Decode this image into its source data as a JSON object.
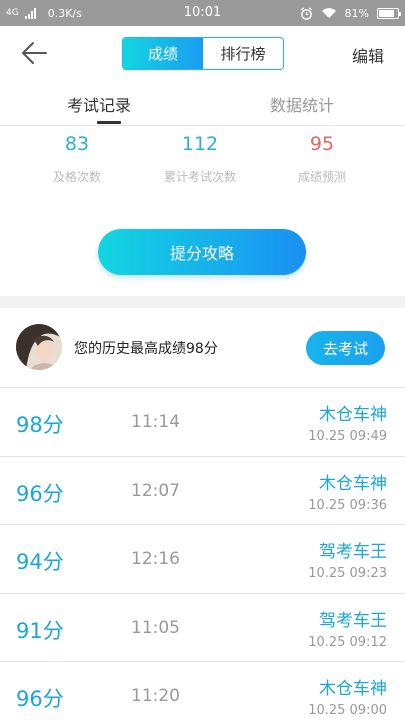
{
  "status_bar": {
    "network": "4G",
    "speed": "0.3K/s",
    "time": "10:01",
    "battery": "81%",
    "battery_level": 0.81
  },
  "nav": {
    "segments": [
      "成绩",
      "排行榜"
    ],
    "active_segment": "成绩",
    "edit_label": "编辑"
  },
  "tabs": {
    "records": "考试记录",
    "stats": "数据统计"
  },
  "stats": [
    {
      "value": "83",
      "label": "及格次数",
      "color": "#2bb0dc"
    },
    {
      "value": "112",
      "label": "累计考试次数",
      "color": "#2bb0dc"
    },
    {
      "value": "95",
      "label": "成绩预测",
      "color": "#e0685e"
    }
  ],
  "boost_button": "提分攻略",
  "best": {
    "text": "您的历史最高成绩98分",
    "button": "去考试"
  },
  "records": [
    {
      "score": "98分",
      "duration": "11:14",
      "name": "木仓车神",
      "date": "10.25  09:49"
    },
    {
      "score": "96分",
      "duration": "12:07",
      "name": "木仓车神",
      "date": "10.25  09:36"
    },
    {
      "score": "94分",
      "duration": "12:16",
      "name": "驾考车王",
      "date": "10.25  09:23"
    },
    {
      "score": "91分",
      "duration": "11:05",
      "name": "驾考车王",
      "date": "10.25  09:12"
    },
    {
      "score": "96分",
      "duration": "11:20",
      "name": "木仓车神",
      "date": "10.25  09:00"
    }
  ]
}
